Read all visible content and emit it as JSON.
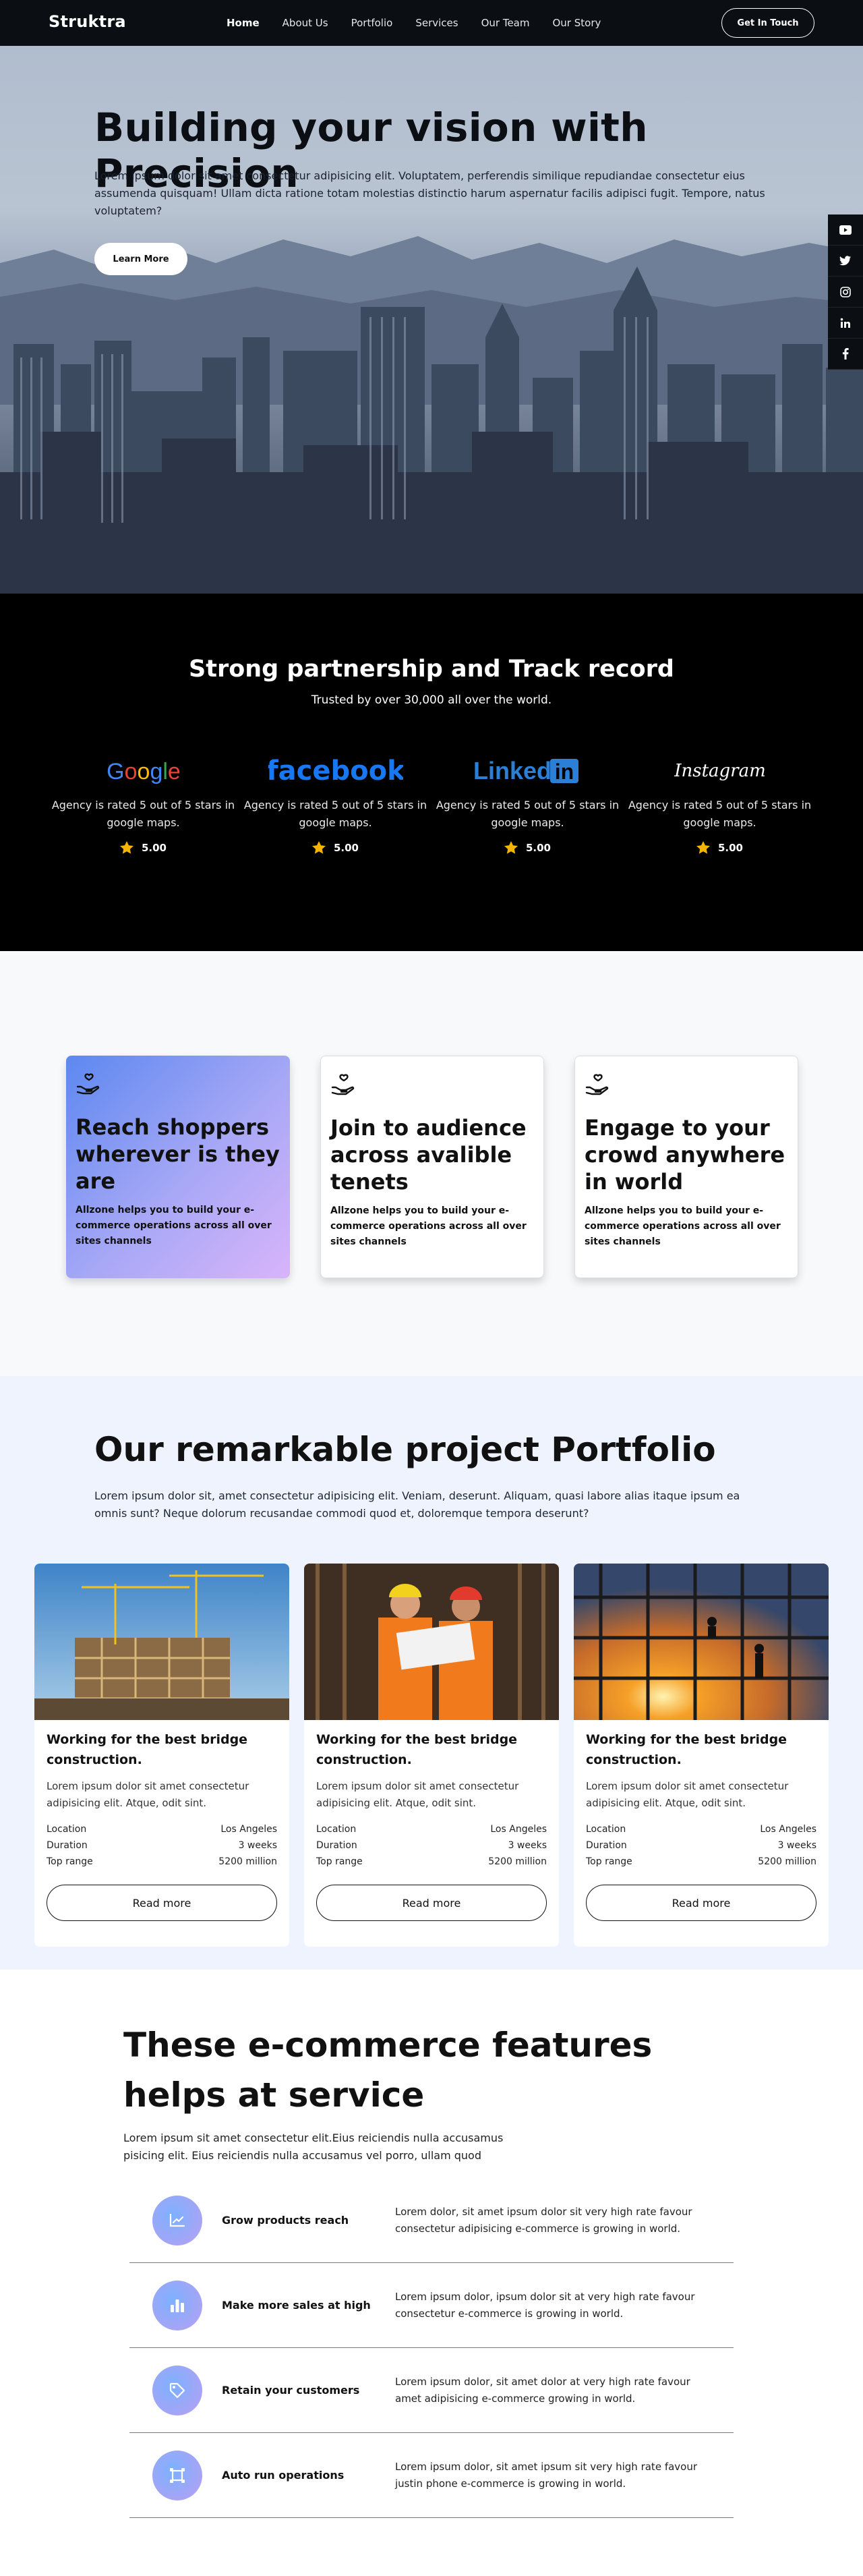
{
  "nav": {
    "brand": "Struktra",
    "items": [
      "Home",
      "About Us",
      "Portfolio",
      "Services",
      "Our Team",
      "Our Story"
    ],
    "cta": "Get In Touch"
  },
  "hero": {
    "title": "Building your vision with Precision",
    "subtitle": "Lorem ipsum dolor sit amet consectetur adipisicing elit. Voluptatem, perferendis similique repudiandae consectetur eius assumenda quisquam! Ullam dicta ratione totam molestias distinctio harum aspernatur facilis adipisci fugit. Tempore, natus voluptatem?",
    "button": "Learn More",
    "social": [
      "youtube-icon",
      "twitter-icon",
      "instagram-icon",
      "linkedin-icon",
      "facebook-icon"
    ]
  },
  "partners": {
    "title": "Strong partnership and Track record",
    "subtitle": "Trusted by over 30,000 all over the world.",
    "brands": [
      {
        "logo": "Google",
        "text": "Agency is rated 5 out of 5 stars in google maps.",
        "rating": "5.00"
      },
      {
        "logo": "facebook",
        "text": "Agency is rated 5 out of 5 stars in google maps.",
        "rating": "5.00"
      },
      {
        "logo": "LinkedIn",
        "text": "Agency is rated 5 out of 5 stars in google maps.",
        "rating": "5.00"
      },
      {
        "logo": "Instagram",
        "text": "Agency is rated 5 out of 5 stars in google maps.",
        "rating": "5.00"
      }
    ]
  },
  "cards": [
    {
      "title": "Reach shoppers wherever is they are",
      "text": "Allzone helps you to build your e-commerce operations across all over sites channels"
    },
    {
      "title": "Join to audience across avalible tenets",
      "text": "Allzone helps you to build your e-commerce operations across all over sites channels"
    },
    {
      "title": "Engage to your crowd anywhere in world",
      "text": "Allzone helps you to build your e-commerce operations across all over sites channels"
    }
  ],
  "portfolio": {
    "title": "Our remarkable project Portfolio",
    "desc": "Lorem ipsum dolor sit, amet consectetur adipisicing elit. Veniam, deserunt. Aliquam, quasi labore alias itaque ipsum ea omnis sunt? Neque dolorum recusandae commodi quod et, doloremque tempora deserunt?",
    "projects": [
      {
        "title": "Working for the best bridge construction.",
        "text": "Lorem ipsum dolor sit amet consectetur adipisicing elit. Atque, odit sint.",
        "location_label": "Location",
        "location": "Los Angeles",
        "duration_label": "Duration",
        "duration": "3 weeks",
        "range_label": "Top range",
        "range": "5200 million",
        "button": "Read more"
      },
      {
        "title": "Working for the best bridge construction.",
        "text": "Lorem ipsum dolor sit amet consectetur adipisicing elit. Atque, odit sint.",
        "location_label": "Location",
        "location": "Los Angeles",
        "duration_label": "Duration",
        "duration": "3 weeks",
        "range_label": "Top range",
        "range": "5200 million",
        "button": "Read more"
      },
      {
        "title": "Working for the best bridge construction.",
        "text": "Lorem ipsum dolor sit amet consectetur adipisicing elit. Atque, odit sint.",
        "location_label": "Location",
        "location": "Los Angeles",
        "duration_label": "Duration",
        "duration": "3 weeks",
        "range_label": "Top range",
        "range": "5200 million",
        "button": "Read more"
      }
    ]
  },
  "ecom": {
    "title": "These e-commerce features helps at service",
    "desc": "Lorem ipsum sit amet consectetur elit.Eius reiciendis nulla accusamus pisicing elit. Eius reiciendis nulla accusamus vel porro, ullam quod",
    "features": [
      {
        "icon": "chart-line-icon",
        "title": "Grow products reach",
        "text": "Lorem dolor, sit amet ipsum dolor sit very high rate favour consectetur adipisicing e-commerce is growing in world."
      },
      {
        "icon": "bar-chart-icon",
        "title": "Make more sales at high",
        "text": "Lorem ipsum dolor, ipsum dolor sit at very high rate favour consectetur e-commerce is growing in world."
      },
      {
        "icon": "tag-icon",
        "title": "Retain your customers",
        "text": "Lorem ipsum dolor, sit amet dolor at very high rate favour amet adipisicing e-commerce growing in world."
      },
      {
        "icon": "frame-icon",
        "title": "Auto run operations",
        "text": "Lorem ipsum dolor, sit amet ipsum sit very high rate favour justin phone e-commerce is growing in world."
      }
    ]
  }
}
